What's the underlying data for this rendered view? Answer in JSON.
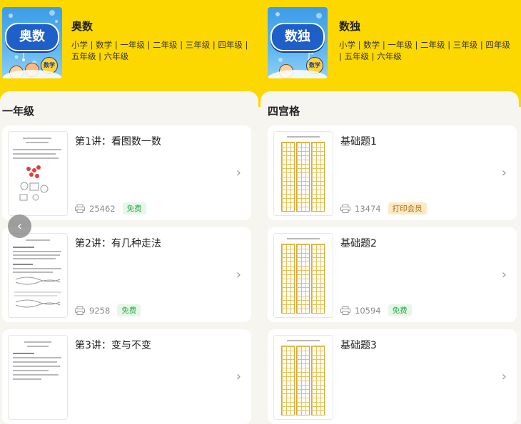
{
  "panels": [
    {
      "cover_label": "奥数",
      "cover_badge": "数学",
      "title": "奥数",
      "tags": "小学 | 数学 | 一年级 | 二年级 | 三年级 | 四年级 | 五年级 | 六年级",
      "section": "一年级",
      "items": [
        {
          "title": "第1讲：看图数一数",
          "count": "25462",
          "badge": "免费",
          "badge_type": "free"
        },
        {
          "title": "第2讲：有几种走法",
          "count": "9258",
          "badge": "免费",
          "badge_type": "free"
        },
        {
          "title": "第3讲：变与不变",
          "count": "",
          "badge": "",
          "badge_type": ""
        }
      ]
    },
    {
      "cover_label": "数独",
      "cover_badge": "数学",
      "title": "数独",
      "tags": "小学 | 数学 | 一年级 | 二年级 | 三年级 | 四年级 | 五年级 | 六年级",
      "section": "四宫格",
      "items": [
        {
          "title": "基础题1",
          "count": "13474",
          "badge": "打印会员",
          "badge_type": "vip"
        },
        {
          "title": "基础题2",
          "count": "10594",
          "badge": "免费",
          "badge_type": "free"
        },
        {
          "title": "基础题3",
          "count": "",
          "badge": "",
          "badge_type": ""
        }
      ]
    }
  ],
  "icons": {
    "chevron": "chevron-right-icon",
    "print": "printer-icon",
    "back": "chevron-left-icon"
  },
  "colors": {
    "header_bg": "#fcd800",
    "free_badge": "#28a745",
    "vip_badge": "#b36b00"
  },
  "nav": {
    "back_glyph": "‹",
    "chevron_glyph": "›"
  }
}
